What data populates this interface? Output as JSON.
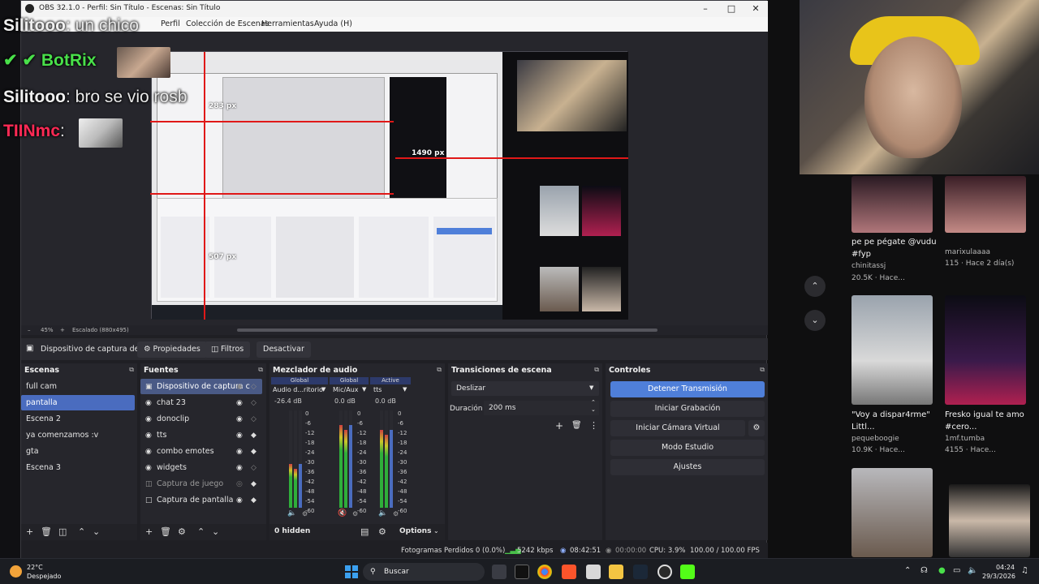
{
  "window": {
    "title": "OBS 32.1.0 - Perfil: Sin Título - Escenas: Sin Título",
    "menu": [
      "Perfil",
      "Colección de Escenas",
      "Herramientas",
      "Ayuda (H)"
    ]
  },
  "chat_overlay": [
    {
      "user": "Silitooo",
      "message": ": un chico"
    },
    {
      "user": "BotRix",
      "message": ""
    },
    {
      "user": "Silitooo",
      "message": ": bro se vio rosb"
    },
    {
      "user": "TIINmc",
      "message": ":"
    }
  ],
  "preview": {
    "measure_labels": [
      "283 px",
      "1490 px",
      "507 px"
    ],
    "zoom": "45%",
    "scale_label": "Escalado (880x495)"
  },
  "context_bar": {
    "source_name": "Dispositivo de captura de v",
    "properties": "Propiedades",
    "filters": "Filtros",
    "deactivate": "Desactivar"
  },
  "scenes": {
    "title": "Escenas",
    "items": [
      "full cam",
      "pantalla",
      "Escena 2",
      "ya comenzamos :v",
      "gta",
      "Escena 3"
    ],
    "selected": "pantalla"
  },
  "sources": {
    "title": "Fuentes",
    "items": [
      "Dispositivo de captura c",
      "chat 23",
      "donoclip",
      "tts",
      "combo emotes",
      "widgets",
      "Captura de juego",
      "Captura de pantalla"
    ]
  },
  "mixer": {
    "title": "Mezclador de audio",
    "channels": [
      {
        "header": "Global",
        "name": "Audio d...ritorio",
        "db": "-26.4 dB",
        "level": 0.45
      },
      {
        "header": "Global",
        "name": "Mic/Aux",
        "db": "0.0 dB",
        "level": 0.85
      },
      {
        "header": "Active",
        "name": "tts",
        "db": "0.0 dB",
        "level": 0.8
      }
    ],
    "scale": [
      "0",
      "-6",
      "-12",
      "-18",
      "-24",
      "-30",
      "-36",
      "-42",
      "-48",
      "-54",
      "-60"
    ],
    "hidden": "0 hidden",
    "options": "Options"
  },
  "transitions": {
    "title": "Transiciones de escena",
    "type": "Deslizar",
    "duration_label": "Duración",
    "duration_value": "200 ms"
  },
  "controls": {
    "title": "Controles",
    "buttons": [
      "Detener Transmisión",
      "Iniciar Grabación",
      "Iniciar Cámara Virtual",
      "Modo Estudio",
      "Ajustes"
    ]
  },
  "status": {
    "dropped": "Fotogramas Perdidos 0 (0.0%)",
    "bitrate": "5242 kbps",
    "stream_time": "08:42:51",
    "rec_time": "00:00:00",
    "cpu": "CPU: 3.9%",
    "fps": "100.00 / 100.00 FPS"
  },
  "side_feed": [
    {
      "caption": "pe pe pégate @vudu #fyp",
      "author": "chinitassj",
      "stats": "20.5K · Hace..."
    },
    {
      "caption": "",
      "author": "marixulaaaa",
      "stats": "115 · Hace 2 día(s)"
    },
    {
      "caption": "\"Voy a dispar4rme\" Littl...",
      "author": "pequeboogie",
      "stats": "10.9K · Hace..."
    },
    {
      "caption": "Fresko igual te amo #cero...",
      "author": "1mf.tumba",
      "stats": "4155 · Hace..."
    }
  ],
  "taskbar": {
    "temp": "22°C",
    "weather": "Despejado",
    "search": "Buscar",
    "time": "04:24",
    "date": "29/3/2026"
  }
}
